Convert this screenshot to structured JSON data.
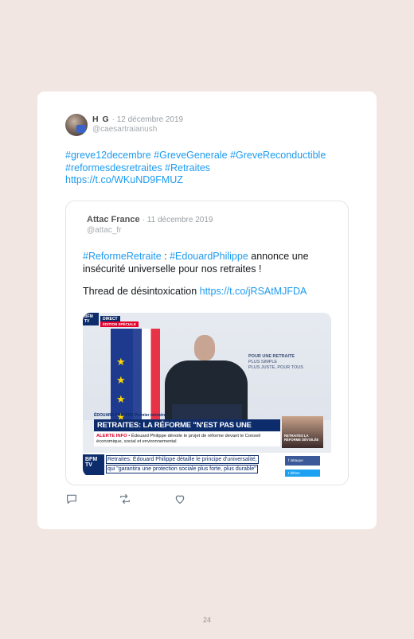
{
  "tweet": {
    "author_name": "H G",
    "date": "· 12 décembre 2019",
    "handle": "@caesartraianush",
    "hashtags_line1": "#greve12decembre #GreveGenerale #GreveReconductible",
    "hashtags_line2": "#reformesdesretraites #Retraites",
    "link": "https://t.co/WKuND9FMUZ"
  },
  "quoted": {
    "author_name": "Attac France",
    "date": "· 11 décembre 2019",
    "handle": "@attac_fr",
    "hashtag1": "#ReformeRetraite",
    "separator": " : ",
    "hashtag2": "#EdouardPhilippe",
    "text_after": " annonce une insécurité universelle pour nos retraites !",
    "thread_text": "Thread de désintoxication ",
    "thread_link": "https://t.co/jRSAtMJFDA"
  },
  "video": {
    "channel_top": "BFM TV",
    "live_badge": "DIRECT",
    "special_badge": "ÉDITION SPÉCIALE",
    "screen_text_1": "POUR UNE RETRAITE",
    "screen_text_2": "PLUS SIMPLE",
    "screen_text_3": "PLUS JUSTE, POUR TOUS",
    "speaker_name": "ÉDOUARD PHILIPPE Premier ministre",
    "headline": "RETRAITES: LA RÉFORME \"N'EST PAS UNE BATAILLE\"",
    "alert_tag": "ALERTE INFO •",
    "alert_text": " Édouard Philippe dévoile le projet de réforme devant le Conseil économique, social et environnemental",
    "inset_text": "RETRAITES LA RÉFORME DÉVOILÉE",
    "channel_bottom": "BFM TV",
    "ticker_line1": "Retraites: Édouard Philippe détaille le principe d'universalité,",
    "ticker_line2": "qui \"garantira une protection sociale plus forte, plus durable\"",
    "facebook_label": "f /attaque",
    "twitter_label": "t /bfmtv"
  },
  "actions": {
    "reply_icon": "reply-icon",
    "retweet_icon": "retweet-icon",
    "like_icon": "heart-icon"
  },
  "page_number": "24"
}
